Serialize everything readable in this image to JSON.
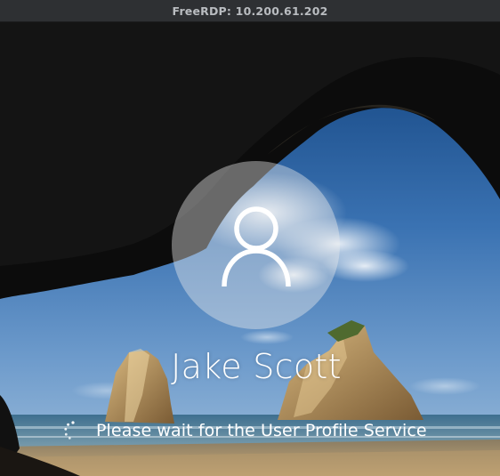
{
  "window": {
    "title": "FreeRDP: 10.200.61.202"
  },
  "lock_screen": {
    "avatar_icon": "user-silhouette-icon",
    "username": "Jake Scott",
    "status_message": "Please wait for the User Profile Service",
    "spinner_icon": "loading-spinner-icon"
  }
}
